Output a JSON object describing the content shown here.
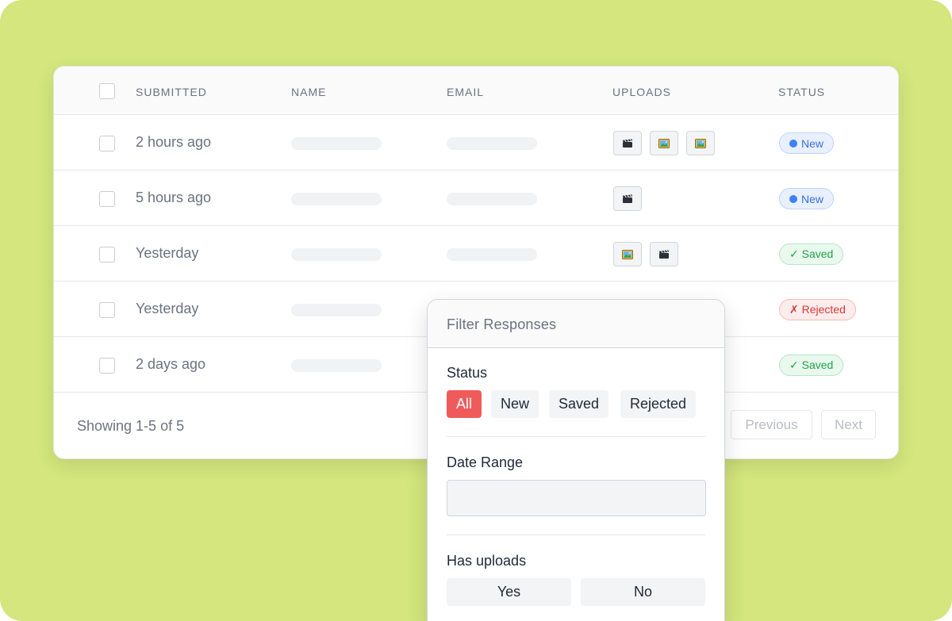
{
  "table": {
    "headers": {
      "submitted": "SUBMITTED",
      "name": "NAME",
      "email": "EMAIL",
      "uploads": "UPLOADS",
      "status": "STATUS"
    },
    "rows": [
      {
        "submitted": "2 hours ago",
        "uploads": [
          "video-icon",
          "image-icon",
          "image-icon"
        ],
        "status": "New",
        "status_type": "new"
      },
      {
        "submitted": "5 hours ago",
        "uploads": [
          "video-icon"
        ],
        "status": "New",
        "status_type": "new"
      },
      {
        "submitted": "Yesterday",
        "uploads": [
          "image-icon",
          "video-icon"
        ],
        "status": "✓ Saved",
        "status_type": "saved"
      },
      {
        "submitted": "Yesterday",
        "uploads": [],
        "status": "✗ Rejected",
        "status_type": "rejected"
      },
      {
        "submitted": "2 days ago",
        "uploads": [],
        "status": "✓ Saved",
        "status_type": "saved"
      }
    ],
    "footer": {
      "showing": "Showing 1-5 of 5",
      "previous": "Previous",
      "next": "Next"
    }
  },
  "filter": {
    "title": "Filter Responses",
    "status_label": "Status",
    "status_options": [
      "All",
      "New",
      "Saved",
      "Rejected"
    ],
    "status_selected": "All",
    "date_range_label": "Date Range",
    "has_uploads_label": "Has uploads",
    "yes": "Yes",
    "no": "No"
  },
  "colors": {
    "background": "#d4e67d",
    "accent": "#ef5b5b",
    "new": "#3b6fd8",
    "saved": "#22a04b",
    "rejected": "#d63a3a"
  }
}
